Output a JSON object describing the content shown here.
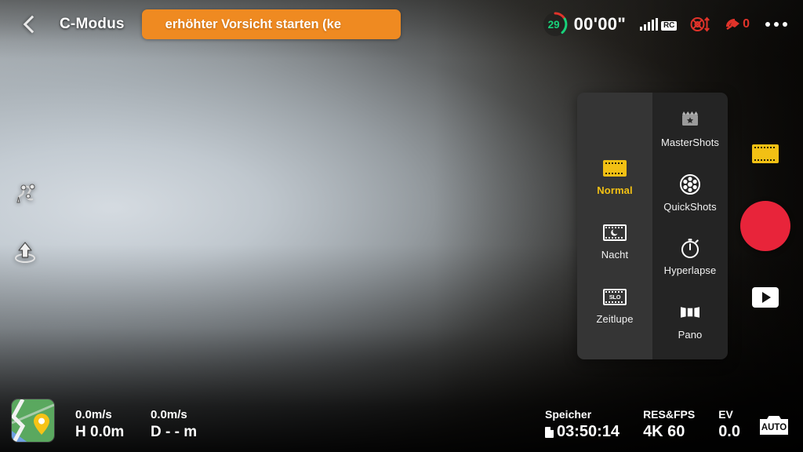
{
  "topbar": {
    "back_icon": "chevron-left-icon",
    "mode_label": "C-Modus",
    "warning_banner": {
      "text": "erhöhter Vorsicht starten (ke",
      "color": "#ef8a21"
    },
    "battery": {
      "percent": "29",
      "ring_color": "#18d17a",
      "warn_color": "#e0332a"
    },
    "flight_timer": "00'00\"",
    "rc_signal": {
      "label": "RC",
      "bars": 5,
      "icon": "signal-bars-icon"
    },
    "gps_status": {
      "icon": "gps-warning-icon",
      "color": "#e0332a"
    },
    "satellite": {
      "icon": "satellite-icon",
      "count": "0",
      "color": "#e0332a"
    },
    "more_menu": {
      "icon": "more-dots-icon"
    }
  },
  "left_icons": [
    {
      "name": "waypoint-route-icon",
      "label": "Flugroute"
    },
    {
      "name": "takeoff-icon",
      "label": "Start"
    }
  ],
  "right_rail": {
    "film_chip_icon": "film-strip-icon",
    "record_button": {
      "name": "record-button",
      "color": "#e8243a"
    },
    "playback_button": {
      "name": "playback-button",
      "icon": "play-icon"
    }
  },
  "mode_panel": {
    "left_column": [
      {
        "id": "normal",
        "label": "Normal",
        "icon": "film-normal-icon",
        "active": true,
        "disabled": false
      },
      {
        "id": "nacht",
        "label": "Nacht",
        "icon": "film-night-icon",
        "active": false,
        "disabled": false
      },
      {
        "id": "zeitlupe",
        "label": "Zeitlupe",
        "icon": "film-slowmo-icon",
        "active": false,
        "disabled": false,
        "icon_text": "SLO"
      }
    ],
    "right_column": [
      {
        "id": "mastershots",
        "label": "MasterShots",
        "icon": "clapper-star-icon",
        "active": false,
        "disabled": true
      },
      {
        "id": "quickshots",
        "label": "QuickShots",
        "icon": "film-reel-icon",
        "active": false,
        "disabled": false
      },
      {
        "id": "hyperlapse",
        "label": "Hyperlapse",
        "icon": "stopwatch-icon",
        "active": false,
        "disabled": false
      },
      {
        "id": "pano",
        "label": "Pano",
        "icon": "panorama-icon",
        "active": false,
        "disabled": false
      }
    ]
  },
  "bottombar": {
    "map_thumbnail": {
      "name": "map-thumbnail",
      "icon": "map-pin-icon"
    },
    "telemetry": {
      "vertical_speed": "0.0m/s",
      "horizontal_speed": "0.0m/s",
      "height_prefix": "H",
      "height_value": "0.0m",
      "distance_prefix": "D",
      "distance_value": "- - m"
    },
    "camera_info": [
      {
        "id": "storage",
        "header": "Speicher",
        "value": "03:50:14",
        "icon": "sd-card-icon"
      },
      {
        "id": "res_fps",
        "header": "RES&FPS",
        "value": "4K 60"
      },
      {
        "id": "ev",
        "header": "EV",
        "value": "0.0"
      }
    ],
    "auto_mode_button": {
      "name": "auto-exposure-button",
      "label": "AUTO",
      "icon": "camera-auto-icon"
    }
  }
}
